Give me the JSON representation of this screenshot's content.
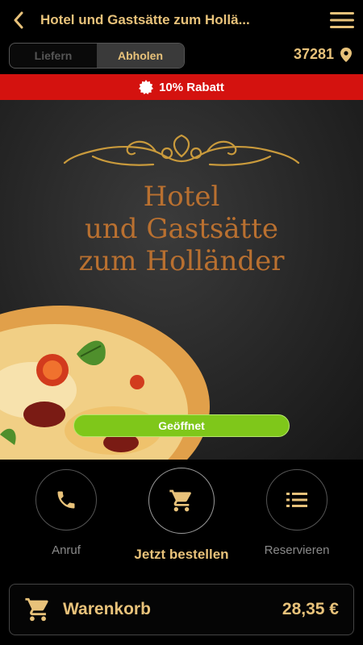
{
  "header": {
    "title": "Hotel und Gastsätte zum Hollä...",
    "back_icon": "chevron-left-icon",
    "menu_icon": "hamburger-menu-icon"
  },
  "delivery_toggle": {
    "options": [
      "Liefern",
      "Abholen"
    ],
    "selected": "Abholen"
  },
  "location": {
    "postal_code": "37281",
    "icon": "map-pin-icon"
  },
  "promo": {
    "text": "10% Rabatt",
    "icon": "badge-icon",
    "color": "#d4120f"
  },
  "hero": {
    "name_lines": [
      "Hotel",
      "und Gastsätte",
      "zum Holländer"
    ],
    "status": "Geöffnet",
    "status_color": "#7fc71a"
  },
  "actions": [
    {
      "label": "Anruf",
      "icon": "phone-icon"
    },
    {
      "label": "Jetzt bestellen",
      "icon": "cart-icon"
    },
    {
      "label": "Reservieren",
      "icon": "list-icon"
    }
  ],
  "cart": {
    "label": "Warenkorb",
    "total": "28,35 €",
    "icon": "cart-icon"
  },
  "colors": {
    "accent": "#e8c27a",
    "background": "#000000"
  }
}
